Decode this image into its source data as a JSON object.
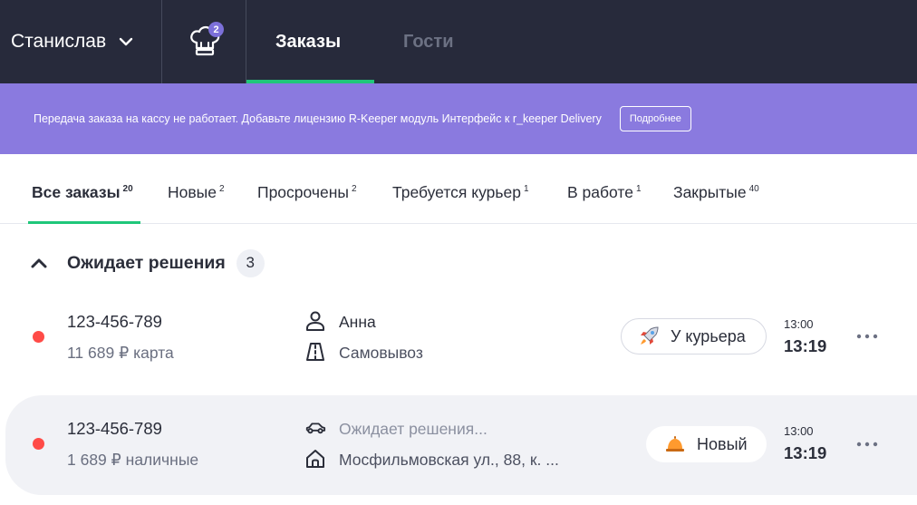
{
  "header": {
    "user_name": "Станислав",
    "kitchen_badge": "2",
    "tabs": [
      {
        "label": "Заказы",
        "active": true
      },
      {
        "label": "Гости",
        "active": false
      }
    ],
    "colors": {
      "background": "#272a3b",
      "accent": "#1fc77a",
      "badge": "#7c70d9"
    }
  },
  "banner": {
    "text": "Передача заказа на кассу не работает. Добавьте лицензию R-Keeper модуль Интерфейс к r_keeper Delivery",
    "button_label": "Подробнее",
    "color": "#8a7adf"
  },
  "filters": [
    {
      "label": "Все заказы",
      "count": "20",
      "active": true
    },
    {
      "label": "Новые",
      "count": "2",
      "active": false
    },
    {
      "label": "Просрочены",
      "count": "2",
      "active": false
    },
    {
      "label": "Требуется курьер",
      "count": "1",
      "active": false
    },
    {
      "label": "В работе",
      "count": "1",
      "active": false
    },
    {
      "label": "Закрытые",
      "count": "40",
      "active": false
    }
  ],
  "group": {
    "title": "Ожидает решения",
    "count": "3"
  },
  "orders": [
    {
      "number": "123-456-789",
      "sum": "11 689 ₽ карта",
      "info_line1": "Анна",
      "info_line1_icon": "person-icon",
      "info_line2": "Самовывоз",
      "info_line2_icon": "road-icon",
      "status": "У курьера",
      "status_icon": "rocket-icon",
      "time_small": "13:00",
      "time_big": "13:19",
      "status_dot_color": "#ff4b47"
    },
    {
      "number": "123-456-789",
      "sum": "1 689 ₽ наличные",
      "info_line1": "Ожидает решения...",
      "info_line1_icon": "car-icon",
      "info_line2": "Мосфильмовская ул., 88, к. ...",
      "info_line2_icon": "house-icon",
      "status": "Новый",
      "status_icon": "bell-icon",
      "time_small": "13:00",
      "time_big": "13:19",
      "status_dot_color": "#ff4b47"
    }
  ]
}
